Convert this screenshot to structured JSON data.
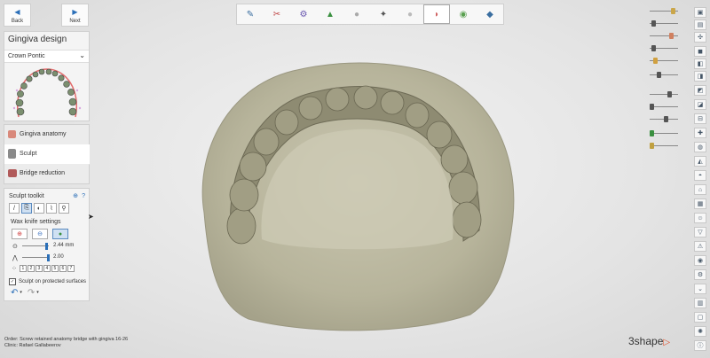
{
  "nav": {
    "back_label": "Back",
    "next_label": "Next"
  },
  "panel": {
    "title": "Gingiva design",
    "dropdown_value": "Crown Pontic",
    "workflow_steps": [
      {
        "label": "Gingiva anatomy",
        "icon": "gingiva-icon"
      },
      {
        "label": "Sculpt",
        "icon": "sculpt-icon"
      },
      {
        "label": "Bridge reduction",
        "icon": "bridge-reduction-icon"
      }
    ],
    "toolkit_title": "Sculpt toolkit",
    "wax_settings_title": "Wax knife settings",
    "radius_value": "2.44 mm",
    "strength_value": "2.00",
    "numbers": [
      "1",
      "2",
      "3",
      "4",
      "5",
      "6",
      "7"
    ],
    "checkbox_label": "Sculpt on protected surfaces"
  },
  "footer": {
    "order_label": "Order:",
    "order_value": "Screw retained anatomy bridge with gingiva 16-26",
    "clinic_label": "Clinic:",
    "clinic_value": "Rafael Gallabeerov",
    "brand": "3shape"
  },
  "colors": {
    "accent": "#2b6fb8",
    "brand_arrow": "#e0502a",
    "model_fill": "#b9b59b"
  }
}
